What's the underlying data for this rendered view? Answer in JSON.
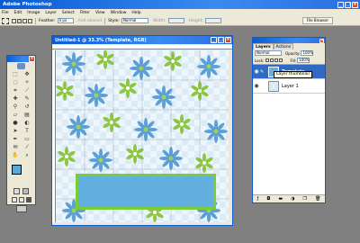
{
  "app": {
    "title": "Adobe Photoshop"
  },
  "menu": [
    "File",
    "Edit",
    "Image",
    "Layer",
    "Select",
    "Filter",
    "View",
    "Window",
    "Help"
  ],
  "options": {
    "feather_label": "Feather:",
    "feather_value": "0 px",
    "antialiased_label": "Anti-aliased",
    "style_label": "Style:",
    "style_value": "Normal",
    "width_label": "Width:",
    "height_label": "Height:"
  },
  "file_browser_label": "File Browser",
  "document": {
    "title": "Untitled-1 @ 33.3% (Template, RGB)"
  },
  "layers_panel": {
    "tabs": [
      "Layers",
      "Actions"
    ],
    "blend_mode": "Normal",
    "opacity_label": "Opacity:",
    "opacity_value": "100%",
    "fill_label": "Fill:",
    "fill_value": "100%",
    "lock_label": "Lock:",
    "layers": [
      {
        "name": "Template",
        "active": true
      },
      {
        "name": "Layer 1",
        "active": false
      }
    ]
  },
  "tooltip": "Layer thumbnail",
  "colors": {
    "accent": "#0a5bd6",
    "foreground": "#5aa8d8",
    "background": "#ffffff",
    "template_fill": "#63b0e0",
    "template_border": "#7acc3a"
  }
}
